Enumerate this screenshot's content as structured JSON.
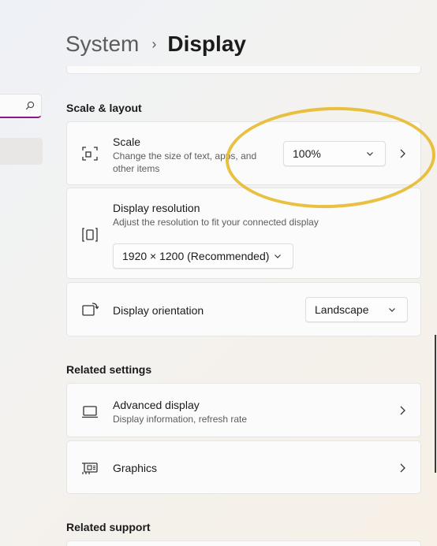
{
  "header": {
    "parent": "System",
    "separator": "›",
    "current": "Display"
  },
  "sections": {
    "scale_layout": "Scale & layout",
    "related_settings": "Related settings",
    "related_support": "Related support"
  },
  "scale": {
    "title": "Scale",
    "description_line1": "Change the size of text, apps, and",
    "description_line2": "other items",
    "value": "100%",
    "icon": "scale-icon"
  },
  "resolution": {
    "title": "Display resolution",
    "description": "Adjust the resolution to fit your connected display",
    "value": "1920 × 1200 (Recommended)",
    "icon": "resolution-icon"
  },
  "orientation": {
    "title": "Display orientation",
    "value": "Landscape",
    "icon": "orientation-icon"
  },
  "advanced_display": {
    "title": "Advanced display",
    "description": "Display information, refresh rate",
    "icon": "monitor-icon"
  },
  "graphics": {
    "title": "Graphics",
    "icon": "gpu-icon"
  },
  "colors": {
    "accent": "#8a1a7e",
    "annotation": "#e8b92c"
  }
}
